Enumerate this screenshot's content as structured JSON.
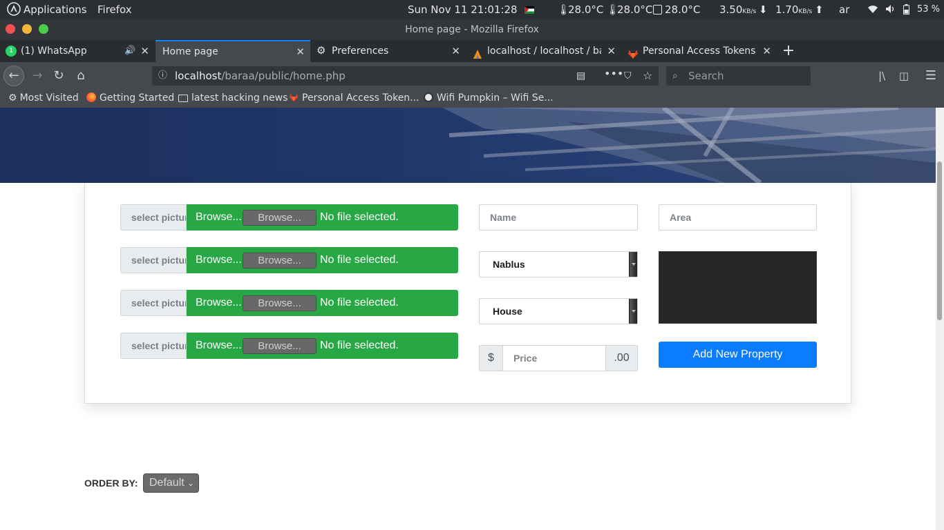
{
  "system_panel": {
    "apps_label": "Applications",
    "app_label": "Firefox",
    "clock": "Sun Nov 11  21:01:28",
    "temp1": "28.0°C",
    "temp2": "28.0°C",
    "temp3": "28.0°C",
    "down_speed": "3.50",
    "up_speed": "1.70",
    "speed_unit": "KB/s",
    "keyboard_layout": "ar",
    "battery": "53 %"
  },
  "window": {
    "title": "Home page - Mozilla Firefox"
  },
  "tabs": [
    {
      "label": "(1) WhatsApp",
      "badge": "1"
    },
    {
      "label": "Home page"
    },
    {
      "label": "Preferences"
    },
    {
      "label": "localhost / localhost / bar"
    },
    {
      "label": "Personal Access Tokens"
    }
  ],
  "navbar": {
    "url_host": "localhost",
    "url_path": "/baraa/public/home.php",
    "search_placeholder": "Search"
  },
  "bookmarks": [
    {
      "label": "Most Visited"
    },
    {
      "label": "Getting Started"
    },
    {
      "label": "latest hacking news"
    },
    {
      "label": "Personal Access Token..."
    },
    {
      "label": "Wifi Pumpkin – Wifi Se..."
    }
  ],
  "form": {
    "picture_rows": [
      {
        "prefix": "select picture",
        "browse": "Browse...",
        "button": "Browse...",
        "status": "No file selected."
      },
      {
        "prefix": "select picture",
        "browse": "Browse...",
        "button": "Browse...",
        "status": "No file selected."
      },
      {
        "prefix": "select picture",
        "browse": "Browse...",
        "button": "Browse...",
        "status": "No file selected."
      },
      {
        "prefix": "select picture",
        "browse": "Browse...",
        "button": "Browse...",
        "status": "No file selected."
      }
    ],
    "name_placeholder": "Name",
    "area_placeholder": "Area",
    "city_value": "Nablus",
    "type_value": "House",
    "price_prefix": "$",
    "price_placeholder": "Price",
    "price_suffix": ".00",
    "submit_label": "Add New Property"
  },
  "order": {
    "label": "ORDER BY:",
    "value": "Default"
  },
  "colors": {
    "accent": "#0b7bff",
    "success": "#28a745"
  }
}
